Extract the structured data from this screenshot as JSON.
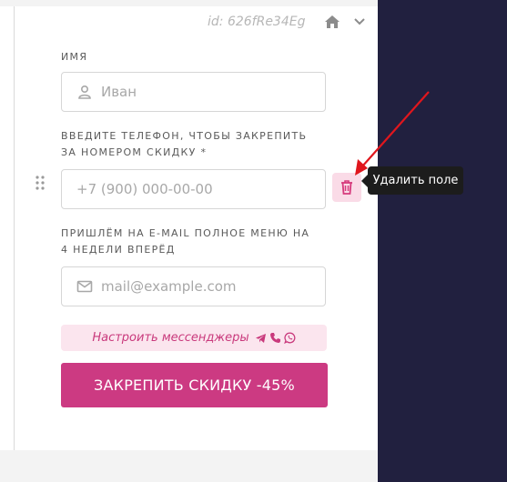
{
  "header": {
    "form_id": "id: 626fRe34Eg"
  },
  "fields": {
    "name": {
      "label": "ИМЯ",
      "placeholder": "Иван"
    },
    "phone": {
      "label": "ВВЕДИТЕ ТЕЛЕФОН, ЧТОБЫ ЗАКРЕПИТЬ ЗА НОМЕРОМ СКИДКУ",
      "required_mark": "*",
      "placeholder": "+7 (900) 000-00-00"
    },
    "email": {
      "label": "ПРИШЛЁМ НА E-MAIL ПОЛНОЕ МЕНЮ НА 4 НЕДЕЛИ ВПЕРЁД",
      "placeholder": "mail@example.com"
    }
  },
  "tooltip": {
    "text": "Удалить поле"
  },
  "messengers": {
    "label": "Настроить мессенджеры",
    "icons": [
      "telegram-icon",
      "phone-icon",
      "whatsapp-icon"
    ]
  },
  "submit": {
    "label": "ЗАКРЕПИТЬ СКИДКУ -45%"
  },
  "icons": [
    "home-icon",
    "chevron-down-icon",
    "user-icon",
    "mail-icon",
    "trash-icon",
    "drag-handle-icon"
  ],
  "colors": {
    "accent": "#cc3a82",
    "accent_light": "#fbe5ee",
    "dark_panel": "#21203f",
    "tooltip_bg": "#1c1c1c",
    "annotation_arrow": "#e0161d"
  }
}
